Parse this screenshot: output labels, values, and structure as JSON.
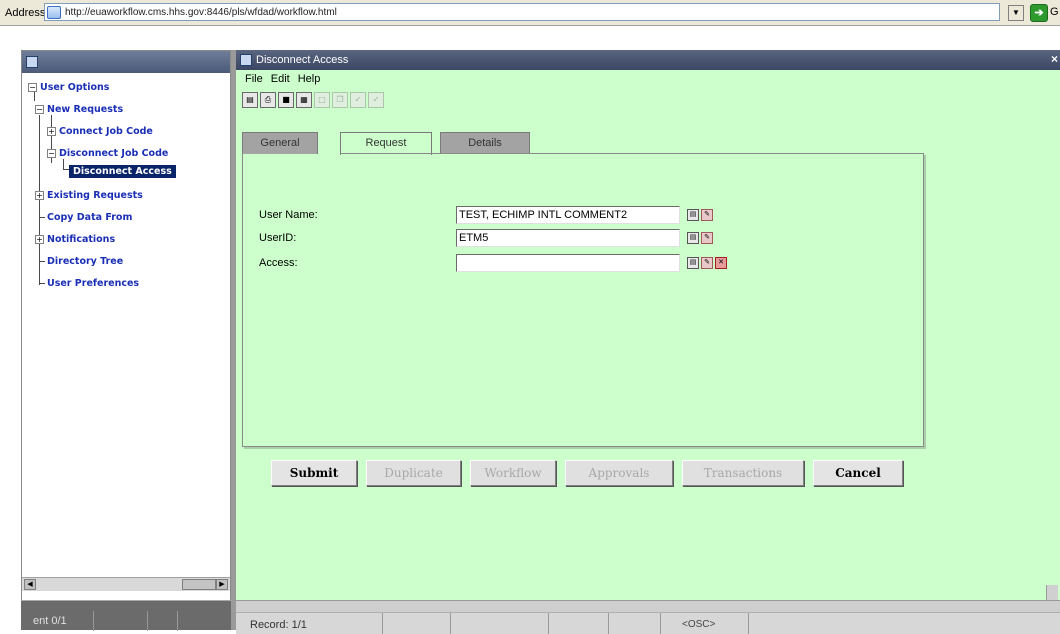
{
  "browser": {
    "address_label": "Address",
    "url": "http://euaworkflow.cms.hhs.gov:8446/pls/wfdad/workflow.html",
    "go_text": "G"
  },
  "navigator": {
    "title": "",
    "tree": [
      {
        "label": "User Options"
      },
      {
        "label": "New Requests"
      },
      {
        "label": "Connect Job Code"
      },
      {
        "label": "Disconnect Job Code"
      },
      {
        "label": "Disconnect Access"
      },
      {
        "label": "Existing Requests"
      },
      {
        "label": "Copy Data From"
      },
      {
        "label": "Notifications"
      },
      {
        "label": "Directory Tree"
      },
      {
        "label": "User Preferences"
      }
    ],
    "status": "ent 0/1"
  },
  "form": {
    "title": "Disconnect Access",
    "close_glyph": "×",
    "menu": [
      "File",
      "Edit",
      "Help"
    ],
    "toolbar_icons": [
      "save-icon",
      "print-icon",
      "disk-icon",
      "query-icon",
      "blank-doc-icon",
      "copy-icon",
      "check-icon",
      "check-icon"
    ],
    "tabs": [
      "General",
      "Request",
      "Details"
    ],
    "active_tab": "Request",
    "fields": [
      {
        "label": "User Name:",
        "value": "TEST, ECHIMP INTL COMMENT2"
      },
      {
        "label": "UserID:",
        "value": "ETM5"
      },
      {
        "label": "Access:",
        "value": ""
      }
    ],
    "buttons": [
      {
        "label": "Submit",
        "enabled": true
      },
      {
        "label": "Duplicate",
        "enabled": false
      },
      {
        "label": "Workflow",
        "enabled": false
      },
      {
        "label": "Approvals",
        "enabled": false
      },
      {
        "label": "Transactions",
        "enabled": false
      },
      {
        "label": "Cancel",
        "enabled": true
      }
    ],
    "status": {
      "record": "Record: 1/1",
      "mode": "<OSC>"
    },
    "colors": {
      "canvas": "#ccffcc",
      "title_bar": "#3b4663",
      "selection": "#0a246a",
      "tree_text": "#1a2fb5"
    }
  }
}
